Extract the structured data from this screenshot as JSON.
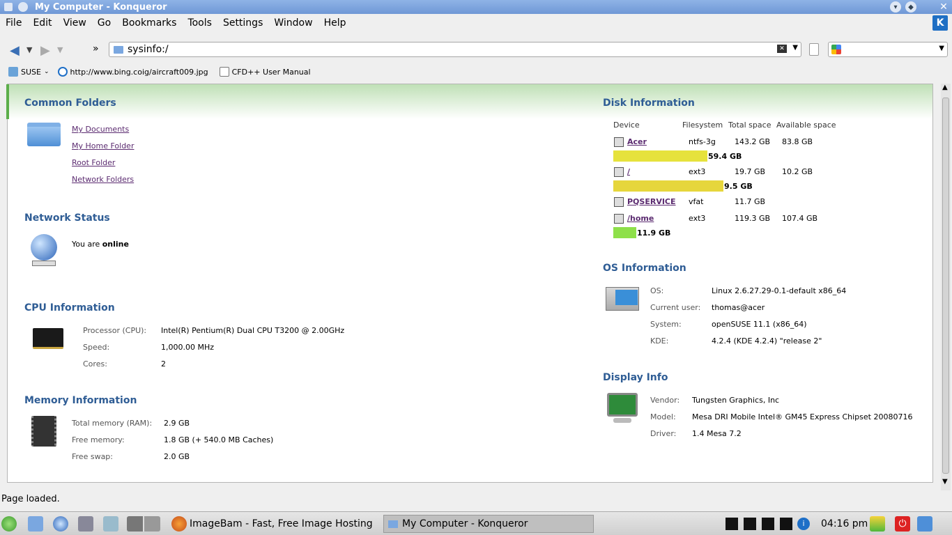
{
  "window": {
    "title": "My Computer - Konqueror"
  },
  "menu": [
    "File",
    "Edit",
    "View",
    "Go",
    "Bookmarks",
    "Tools",
    "Settings",
    "Window",
    "Help"
  ],
  "toolbar": {
    "url": "sysinfo:/",
    "overflow": "»"
  },
  "bookmarks": [
    {
      "label": "SUSE",
      "icon": "suse-folder-icon"
    },
    {
      "label": "http://www.bing.coig/aircraft009.jpg",
      "icon": "bing-icon"
    },
    {
      "label": "CFD++ User Manual",
      "icon": "doc-icon"
    }
  ],
  "common_folders": {
    "title": "Common Folders",
    "links": [
      "My Documents",
      "My Home Folder",
      "Root Folder",
      "Network Folders"
    ]
  },
  "network": {
    "title": "Network Status",
    "prefix": "You are ",
    "state": "online"
  },
  "cpu": {
    "title": "CPU Information",
    "rows": [
      {
        "label": "Processor (CPU):",
        "value": "Intel(R) Pentium(R) Dual CPU T3200 @ 2.00GHz"
      },
      {
        "label": "Speed:",
        "value": "1,000.00 MHz"
      },
      {
        "label": "Cores:",
        "value": "2"
      }
    ]
  },
  "memory": {
    "title": "Memory Information",
    "rows": [
      {
        "label": "Total memory (RAM):",
        "value": "2.9 GB"
      },
      {
        "label": "Free memory:",
        "value": "1.8 GB (+ 540.0 MB Caches)"
      },
      {
        "label": "Free swap:",
        "value": "2.0 GB"
      }
    ]
  },
  "disk": {
    "title": "Disk Information",
    "headers": [
      "Device",
      "Filesystem",
      "Total space",
      "Available space"
    ],
    "rows": [
      {
        "device": "Acer",
        "fs": "ntfs-3g",
        "total": "143.2 GB",
        "avail": "83.8 GB",
        "used": "59.4 GB",
        "used_fraction": 0.41,
        "bar_color": "#e6e23c"
      },
      {
        "device": "/",
        "fs": "ext3",
        "total": "19.7 GB",
        "avail": "10.2 GB",
        "used": "9.5 GB",
        "used_fraction": 0.48,
        "bar_color": "#e6d63c"
      },
      {
        "device": "PQSERVICE",
        "fs": "vfat",
        "total": "11.7 GB",
        "avail": "",
        "used": "",
        "used_fraction": 0,
        "bar_color": ""
      },
      {
        "device": "/home",
        "fs": "ext3",
        "total": "119.3 GB",
        "avail": "107.4 GB",
        "used": "11.9 GB",
        "used_fraction": 0.1,
        "bar_color": "#8ee04a"
      }
    ]
  },
  "os": {
    "title": "OS Information",
    "rows": [
      {
        "label": "OS:",
        "value": "Linux 2.6.27.29-0.1-default x86_64"
      },
      {
        "label": "Current user:",
        "value": "thomas@acer"
      },
      {
        "label": "System:",
        "value": "openSUSE 11.1 (x86_64)"
      },
      {
        "label": "KDE:",
        "value": "4.2.4 (KDE 4.2.4) \"release 2\""
      }
    ]
  },
  "display": {
    "title": "Display Info",
    "rows": [
      {
        "label": "Vendor:",
        "value": "Tungsten Graphics, Inc"
      },
      {
        "label": "Model:",
        "value": "Mesa DRI Mobile Intel® GM45 Express Chipset 20080716"
      },
      {
        "label": "Driver:",
        "value": "1.4 Mesa 7.2"
      }
    ]
  },
  "status": "Page loaded.",
  "taskbar": {
    "tasks": [
      "ImageBam - Fast, Free Image Hosting an",
      "My Computer - Konqueror"
    ],
    "clock": "04:16 pm"
  }
}
